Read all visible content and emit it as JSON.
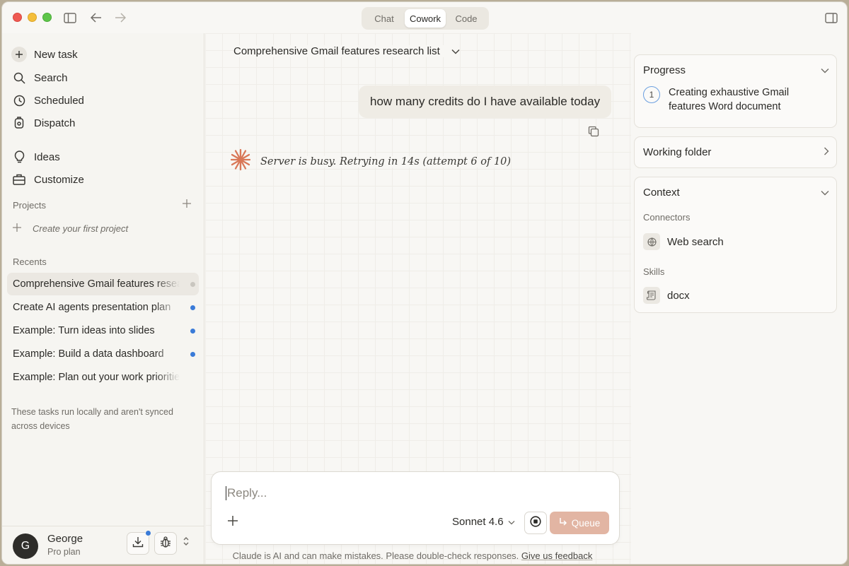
{
  "titlebar": {
    "tabs": [
      "Chat",
      "Cowork",
      "Code"
    ],
    "active_tab": "Cowork"
  },
  "sidebar": {
    "nav": [
      {
        "label": "New task",
        "icon": "plus-icon"
      },
      {
        "label": "Search",
        "icon": "search-icon"
      },
      {
        "label": "Scheduled",
        "icon": "clock-icon"
      },
      {
        "label": "Dispatch",
        "icon": "dispatch-icon"
      },
      {
        "label": "Ideas",
        "icon": "lightbulb-icon"
      },
      {
        "label": "Customize",
        "icon": "briefcase-icon"
      }
    ],
    "projects_label": "Projects",
    "create_project": "Create your first project",
    "recents_label": "Recents",
    "recents": [
      "Comprehensive Gmail features research list",
      "Create AI agents presentation plan",
      "Example: Turn ideas into slides",
      "Example: Build a data dashboard",
      "Example: Plan out your work priorities"
    ],
    "footnote": "These tasks run locally and aren't synced across devices",
    "user": {
      "initial": "G",
      "name": "George",
      "plan": "Pro plan"
    }
  },
  "main": {
    "title": "Comprehensive Gmail features research list",
    "user_message": "how many credits do I have available today",
    "status": "Server is busy. Retrying in 14s (attempt 6 of 10)",
    "composer": {
      "placeholder": "Reply...",
      "model": "Sonnet 4.6",
      "queue_label": "Queue"
    },
    "disclaimer": "Claude is AI and can make mistakes. Please double-check responses.",
    "feedback_link": "Give us feedback"
  },
  "panel": {
    "progress": {
      "title": "Progress",
      "steps": [
        {
          "num": "1",
          "text": "Creating exhaustive Gmail features Word document"
        }
      ]
    },
    "working_folder": {
      "title": "Working folder"
    },
    "context": {
      "title": "Context",
      "connectors_label": "Connectors",
      "connectors": [
        "Web search"
      ],
      "skills_label": "Skills",
      "skills": [
        "docx"
      ]
    }
  },
  "colors": {
    "accent_blue": "#3a7bd8",
    "claude_orange": "#d97757",
    "queue_button": "#e2b5a3"
  }
}
